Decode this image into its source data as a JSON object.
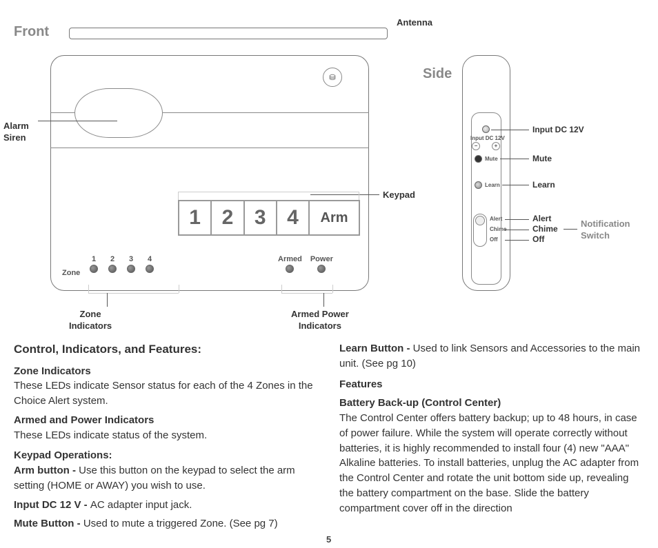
{
  "views": {
    "front": "Front",
    "side": "Side"
  },
  "callouts": {
    "antenna": "Antenna",
    "alarm_siren": "Alarm\nSiren",
    "keypad": "Keypad",
    "zone_indicators": "Zone\nIndicators",
    "armed_power_indicators": "Armed Power\nIndicators",
    "input_dc": "Input DC 12V",
    "mute": "Mute",
    "learn": "Learn",
    "alert": "Alert",
    "chime": "Chime",
    "off": "Off",
    "notif_switch": "Notification\nSwitch"
  },
  "keypad": {
    "k1": "1",
    "k2": "2",
    "k3": "3",
    "k4": "4",
    "arm": "Arm"
  },
  "leds": {
    "zone_label": "Zone",
    "n1": "1",
    "n2": "2",
    "n3": "3",
    "n4": "4",
    "armed": "Armed",
    "power": "Power"
  },
  "side_device": {
    "input_label": "Input DC 12V",
    "minus": "−",
    "plus": "+",
    "mute": "Mute",
    "learn": "Learn",
    "alert": "Alert",
    "chime": "Chime",
    "off": "Off"
  },
  "ge_logo": "⛁",
  "page_number": "5",
  "text": {
    "col1": {
      "h1": "Control, Indicators, and Features:",
      "h2": "Zone Indicators",
      "p1": "These LEDs indicate Sensor status for each of the 4 Zones in the Choice Alert system.",
      "h3": "Armed and Power Indicators",
      "p2": "These LEDs indicate status of the system.",
      "h4": "Keypad Operations:",
      "b1": "Arm button - ",
      "p3": "Use this button on the keypad to select the arm setting (HOME or AWAY) you wish to use.",
      "b2": "Input DC 12 V - ",
      "p4": "AC adapter input jack.",
      "b3": "Mute Button - ",
      "p5": "Used to mute a triggered Zone. (See pg 7)"
    },
    "col2": {
      "b1": "Learn Button - ",
      "p1": "Used to link Sensors and Accessories to the main unit. (See pg 10)",
      "h2": "Features",
      "h3": "Battery Back-up (Control Center)",
      "p2": "The Control Center offers battery backup; up to 48 hours, in case of power failure. While the system will operate correctly without batteries, it is highly recommended to install four (4) new \"AAA\" Alkaline batteries. To install batteries, unplug the AC adapter from the Control Center and rotate the unit bottom side up, revealing the battery compartment on the base. Slide the battery compartment cover off in the direction"
    }
  }
}
